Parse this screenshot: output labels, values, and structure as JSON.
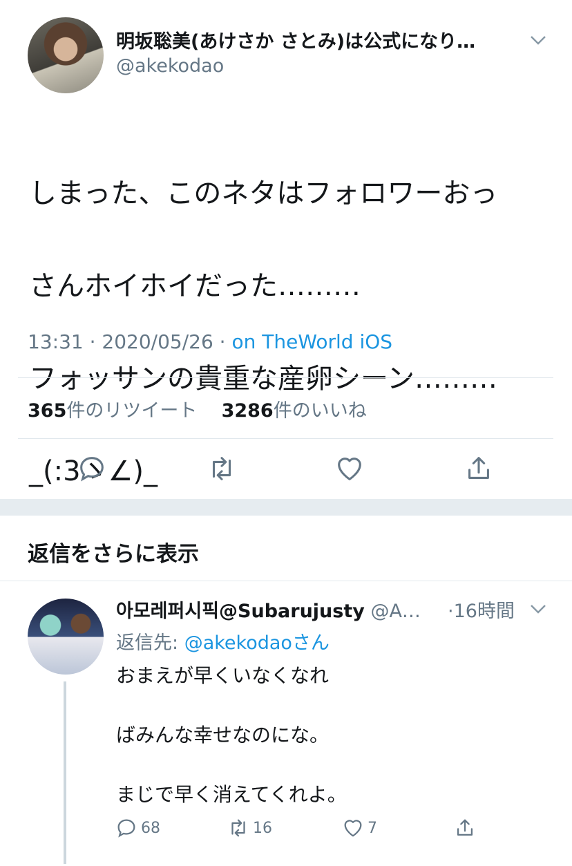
{
  "tweet": {
    "author_name": "明坂聡美(あけさか さとみ)は公式になり…",
    "author_handle": "@akekodao",
    "text_lines": [
      "しまった、このネタはフォロワーおっ",
      "さんホイホイだった………",
      "フォッサンの貴重な産卵シーン………",
      "_(:3ゝ∠)_"
    ],
    "time": "13:31 · 2020/05/26 · ",
    "source": "on TheWorld iOS",
    "retweets_count": "365",
    "retweets_label": "件のリツイート",
    "likes_count": "3286",
    "likes_label": "件のいいね",
    "actions": {
      "reply": "reply-icon",
      "retweet": "retweet-icon",
      "like": "heart-icon",
      "share": "share-icon"
    }
  },
  "show_more_replies": "返信をさらに表示",
  "reply": {
    "author_name": "아모레퍼시픽@Subarujusty",
    "author_handle": "@A…",
    "time": "·16時間",
    "reply_to_prefix": "返信先: ",
    "reply_to_handle": "@akekodao",
    "reply_to_suffix": "さん",
    "lines": [
      "おまえが早くいなくなれ",
      "ばみんな幸せなのにな。",
      "まじで早く消えてくれよ。"
    ],
    "reply_count": "68",
    "retweet_count": "16",
    "like_count": "7"
  },
  "colors": {
    "link": "#1b95e0",
    "secondary_text": "#657786",
    "divider": "#e1e8ed",
    "section_gap": "#e6ecf0"
  }
}
